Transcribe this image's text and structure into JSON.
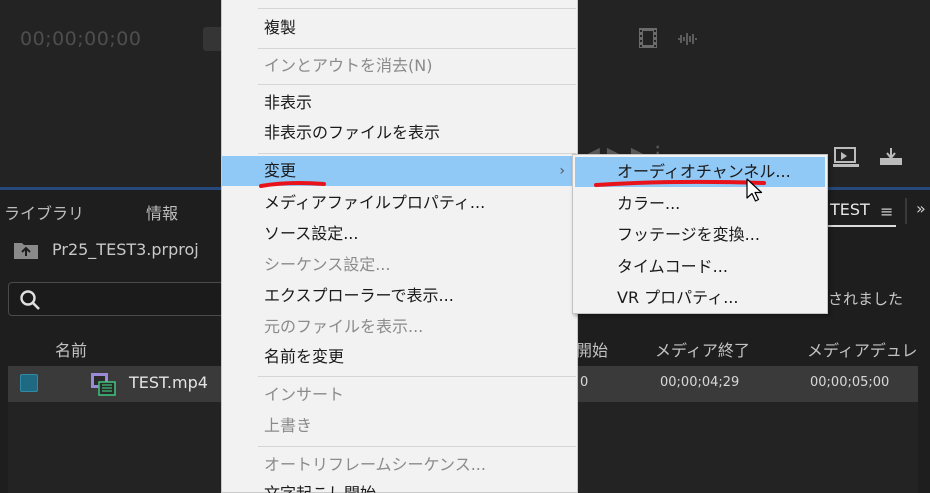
{
  "monitor": {
    "timecode": "00;00;00;00",
    "film_icon": "film-strip-icon",
    "wave_icon": "audio-waveform-icon",
    "controls": [
      "export-frame-icon",
      "insert-icon",
      "overwrite-icon"
    ]
  },
  "project_panel": {
    "tabs": [
      "ライブラリ",
      "情報"
    ],
    "active_tab": "TEST",
    "tab_menu_icon": "≡",
    "tab_overflow_icon": "»",
    "project_name": "Pr25_TEST3.prproj",
    "search_placeholder": "",
    "status_text": "されました",
    "columns": {
      "name": "名前",
      "media_start": "開始",
      "media_end": "メディア終了",
      "media_duration": "メディアデュレ"
    },
    "rows": [
      {
        "name": "TEST.mp4",
        "media_start": "0",
        "media_end": "00;00;04;29",
        "media_duration": "00;00;05;00"
      }
    ]
  },
  "context_menu": {
    "items": [
      {
        "label": "複製",
        "disabled": false
      },
      {
        "label": "インとアウトを消去(N)",
        "disabled": true
      },
      {
        "label": "非表示",
        "disabled": false
      },
      {
        "label": "非表示のファイルを表示",
        "disabled": false
      },
      {
        "label": "変更",
        "disabled": false,
        "submenu": true
      },
      {
        "label": "メディアファイルプロパティ...",
        "disabled": false
      },
      {
        "label": "ソース設定...",
        "disabled": false
      },
      {
        "label": "シーケンス設定...",
        "disabled": true
      },
      {
        "label": "エクスプローラーで表示...",
        "disabled": false
      },
      {
        "label": "元のファイルを表示...",
        "disabled": true
      },
      {
        "label": "名前を変更",
        "disabled": false
      },
      {
        "label": "インサート",
        "disabled": true
      },
      {
        "label": "上書き",
        "disabled": true
      },
      {
        "label": "オートリフレームシーケンス...",
        "disabled": true
      },
      {
        "label": "文字起こし開始",
        "disabled": false
      }
    ],
    "submenu_arrow": "›"
  },
  "submenu": {
    "items": [
      {
        "label": "オーディオチャンネル..."
      },
      {
        "label": "カラー..."
      },
      {
        "label": "フッテージを変換..."
      },
      {
        "label": "タイムコード..."
      },
      {
        "label": "VR プロパティ..."
      }
    ]
  },
  "colors": {
    "menu_bg": "#f2f2f2",
    "highlight": "#90c8f6",
    "annotation_red": "#e8121a",
    "panel_bg": "#1e1e1e",
    "selected_row": "#3a3a3a"
  }
}
